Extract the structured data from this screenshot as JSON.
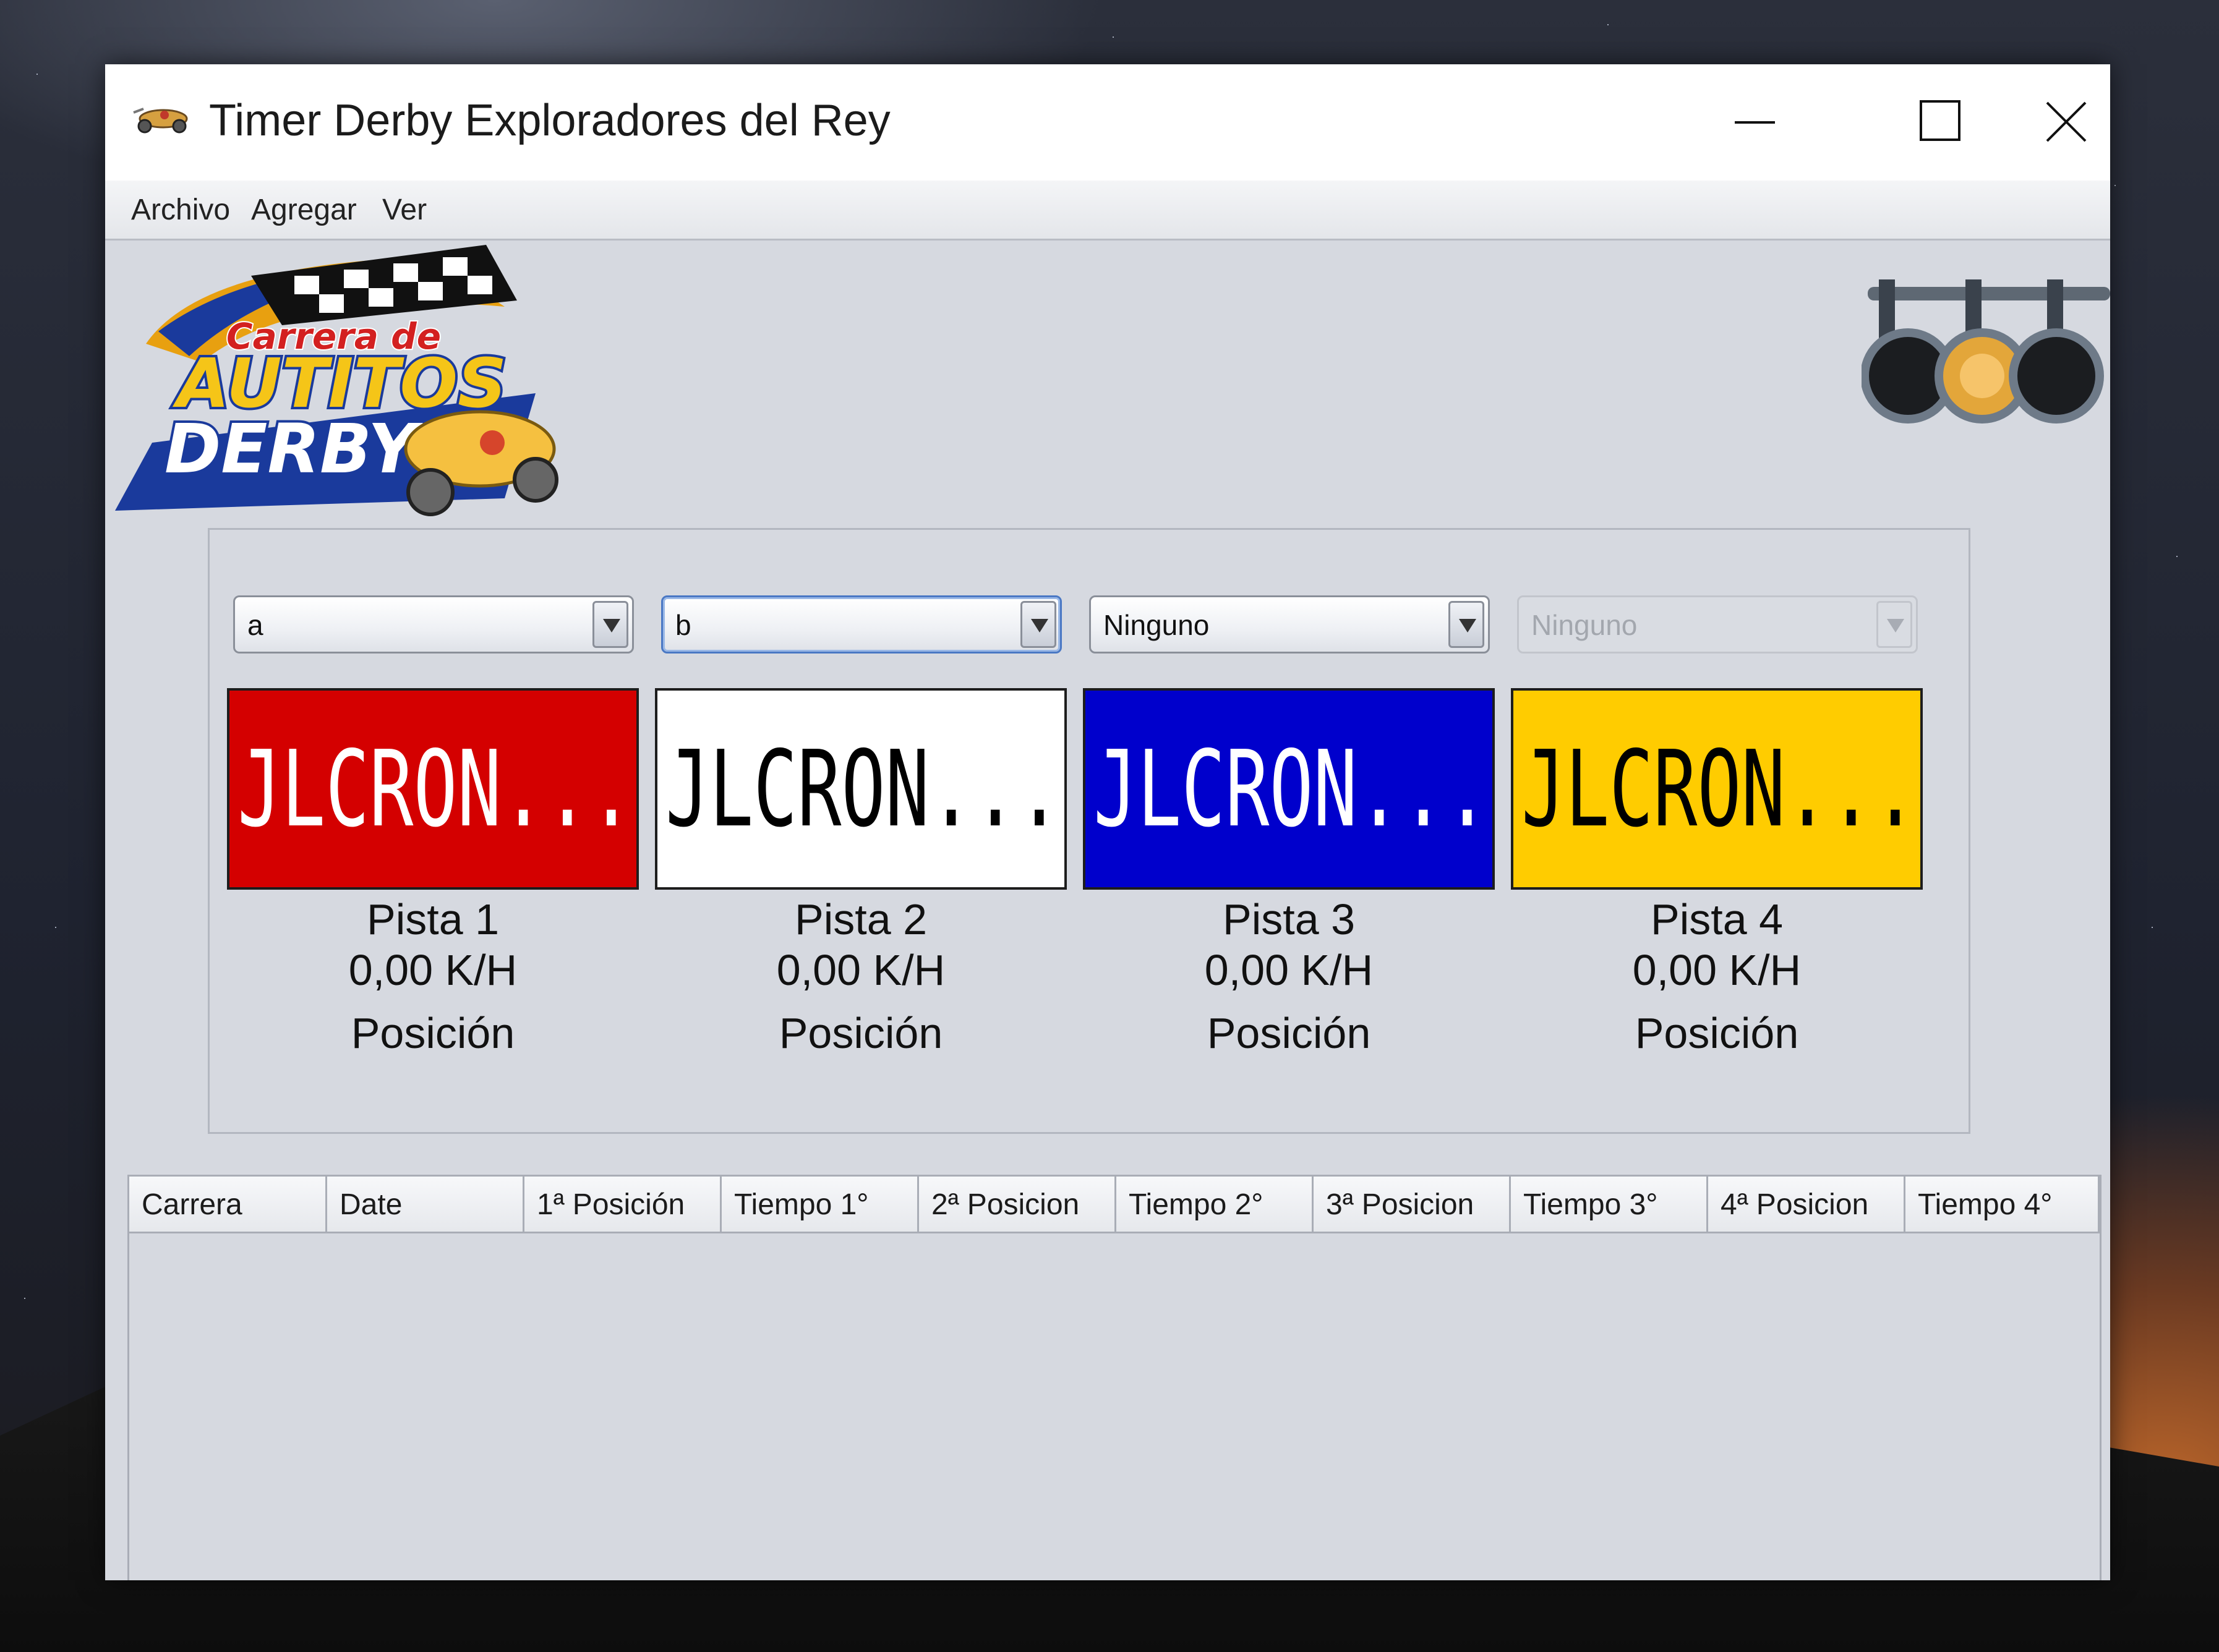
{
  "window": {
    "title": "Timer Derby Exploradores del Rey"
  },
  "menu": {
    "items": [
      "Archivo",
      "Agregar",
      "Ver"
    ]
  },
  "logo": {
    "line1": "Carrera de",
    "line2": "AUTITOS",
    "line3": "DERBY"
  },
  "lanes": [
    {
      "selector": "a",
      "display": "JLCRON...",
      "name": "Pista 1",
      "speed": "0,00 K/H",
      "position": "Posición",
      "color": "#d40000",
      "text_color": "#ffffff"
    },
    {
      "selector": "b",
      "display": "JLCRON...",
      "name": "Pista 2",
      "speed": "0,00 K/H",
      "position": "Posición",
      "color": "#ffffff",
      "text_color": "#000000"
    },
    {
      "selector": "Ninguno",
      "display": "JLCRON...",
      "name": "Pista 3",
      "speed": "0,00 K/H",
      "position": "Posición",
      "color": "#0000cc",
      "text_color": "#ffffff"
    },
    {
      "selector": "Ninguno",
      "display": "JLCRON...",
      "name": "Pista 4",
      "speed": "0,00 K/H",
      "position": "Posición",
      "color": "#ffcc00",
      "text_color": "#000000"
    }
  ],
  "table": {
    "columns": [
      "Carrera",
      "Date",
      "1ª Posición",
      "Tiempo 1°",
      "2ª Posicion",
      "Tiempo 2°",
      "3ª Posicion",
      "Tiempo 3°",
      "4ª Posicion",
      "Tiempo 4°"
    ],
    "rows": []
  }
}
